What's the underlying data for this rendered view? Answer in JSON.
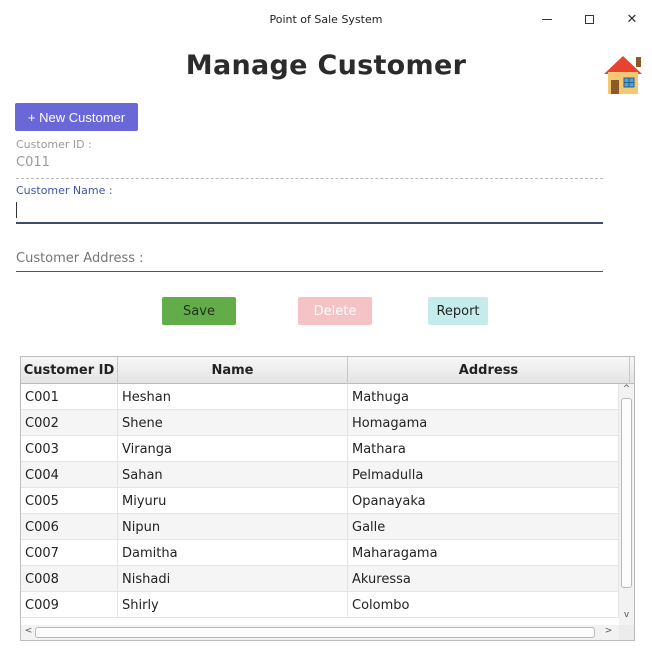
{
  "window": {
    "title": "Point of Sale System",
    "minimize_icon": "minimize-icon",
    "maximize_icon": "maximize-icon",
    "close_icon": "close-icon",
    "close_glyph": "✕"
  },
  "header": {
    "title": "Manage Customer",
    "home_icon": "house-icon"
  },
  "form": {
    "new_customer_label": "+ New Customer",
    "customer_id_label": "Customer ID :",
    "customer_id_value": "C011",
    "customer_name_label": "Customer Name :",
    "customer_name_value": "",
    "customer_address_placeholder": "Customer Address :"
  },
  "actions": {
    "save_label": "Save",
    "delete_label": "Delete",
    "report_label": "Report"
  },
  "colors": {
    "new_button": "#6a67d9",
    "save_button": "#62ad49",
    "delete_button": "#f5c2c5",
    "report_button": "#c5ecec"
  },
  "table": {
    "columns": [
      "Customer ID",
      "Name",
      "Address"
    ],
    "rows": [
      [
        "C001",
        "Heshan",
        "Mathuga"
      ],
      [
        "C002",
        "Shene",
        "Homagama"
      ],
      [
        "C003",
        "Viranga",
        "Mathara"
      ],
      [
        "C004",
        "Sahan",
        "Pelmadulla"
      ],
      [
        "C005",
        "Miyuru",
        "Opanayaka"
      ],
      [
        "C006",
        "Nipun",
        "Galle"
      ],
      [
        "C007",
        "Damitha",
        "Maharagama"
      ],
      [
        "C008",
        "Nishadi",
        "Akuressa"
      ],
      [
        "C009",
        "Shirly",
        "Colombo"
      ]
    ],
    "scroll_up_glyph": "^",
    "scroll_down_glyph": "v",
    "scroll_left_glyph": "<",
    "scroll_right_glyph": ">"
  }
}
